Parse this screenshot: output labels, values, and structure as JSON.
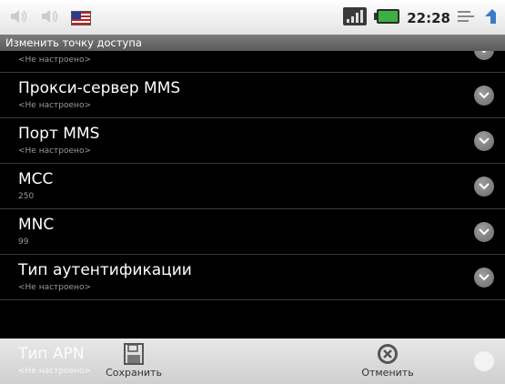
{
  "status_bar": {
    "time": "22:28",
    "icons": [
      "volume-icon",
      "volume-icon",
      "flag-icon",
      "signal-icon",
      "battery-icon",
      "menu-icon",
      "back-icon"
    ]
  },
  "header": {
    "title": "Изменить точку доступа"
  },
  "list": {
    "items": [
      {
        "title": "",
        "subtitle": "<Не настроено>"
      },
      {
        "title": "Прокси-сервер MMS",
        "subtitle": "<Не настроено>"
      },
      {
        "title": "Порт MMS",
        "subtitle": "<Не настроено>"
      },
      {
        "title": "MCC",
        "subtitle": "250"
      },
      {
        "title": "MNC",
        "subtitle": "99"
      },
      {
        "title": "Тип аутентификации",
        "subtitle": "<Не настроено>"
      },
      {
        "title": "Тип APN",
        "subtitle": "<Не настроено>"
      }
    ]
  },
  "bottom_bar": {
    "save_label": "Сохранить",
    "cancel_label": "Отменить"
  },
  "colors": {
    "background": "#000000",
    "title_bar": "#6a6a6a",
    "bottom_bar": "#dcdcdc"
  }
}
